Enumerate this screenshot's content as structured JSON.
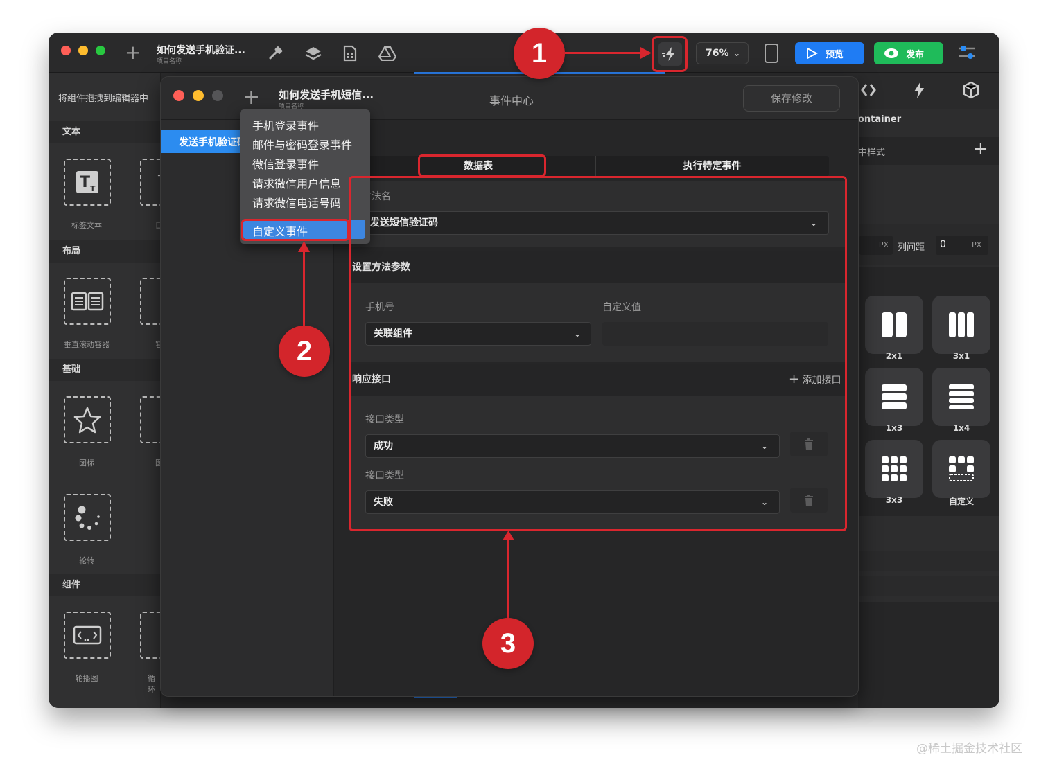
{
  "outer_window": {
    "project_title": "如何发送手机验证...",
    "project_subtitle": "项目名称",
    "zoom": "76%",
    "preview_label": "预览",
    "publish_label": "发布"
  },
  "left_panel": {
    "drag_hint": "将组件拖拽到编辑器中",
    "sections": [
      "文本",
      "布局",
      "基础",
      "组件"
    ],
    "items": [
      "标签文本",
      "垂直滚动容器",
      "图标",
      "轮转",
      "轮播图"
    ],
    "cropped_labels": [
      "目",
      "容",
      "图",
      "循环"
    ]
  },
  "right_panel": {
    "container_label": "ontainer",
    "style_label": "中样式",
    "unit_px": "PX",
    "col_gap_label": "列间距",
    "col_gap_value": "0",
    "layouts": [
      "2x1",
      "3x1",
      "1x3",
      "1x4",
      "3x3",
      "自定义"
    ]
  },
  "event_center": {
    "project_title": "如何发送手机短信...",
    "project_subtitle": "项目名称",
    "center_title": "事件中心",
    "save_label": "保存修改",
    "sidebar_selected": "发送手机验证码",
    "tabs": [
      "数据表",
      "执行特定事件"
    ],
    "method_name_label": "方法名",
    "method_value": "发送短信验证码",
    "params_header": "设置方法参数",
    "phone_label": "手机号",
    "custom_value_label": "自定义值",
    "phone_select_value": "关联组件",
    "response_header": "响应接口",
    "add_interface_label": "添加接口",
    "interface_type_label": "接口类型",
    "interface_values": [
      "成功",
      "失败"
    ]
  },
  "dropdown_menu": {
    "items": [
      "手机登录事件",
      "邮件与密码登录事件",
      "微信登录事件",
      "请求微信用户信息",
      "请求微信电话号码"
    ],
    "selected": "自定义事件"
  },
  "annotations": {
    "numbers": [
      "1",
      "2",
      "3"
    ],
    "color": "#d9262e"
  },
  "watermark": "@稀土掘金技术社区",
  "colors": {
    "preview_blue": "#1f7cf4",
    "publish_green": "#1fbb5a",
    "selected_blue": "#2c8cf0",
    "menu_selected": "#3d86e0"
  }
}
